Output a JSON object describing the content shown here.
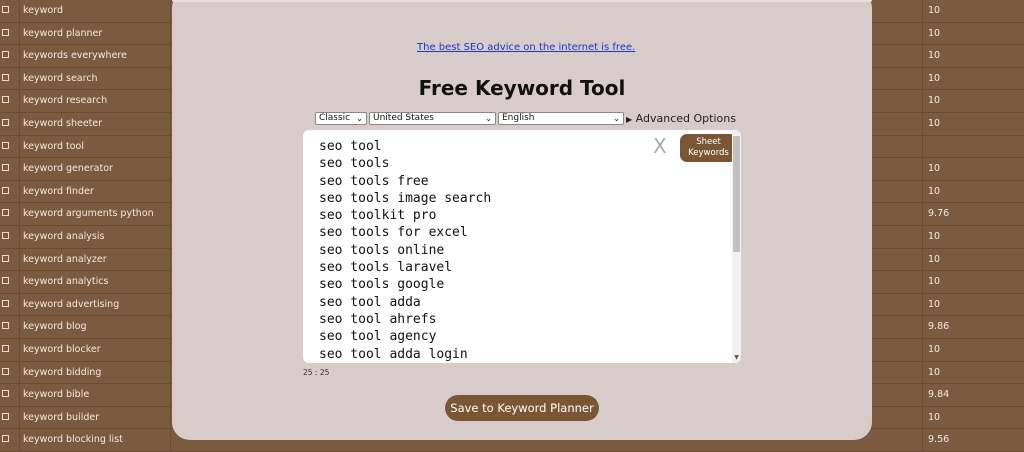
{
  "background_table": {
    "rows": [
      {
        "keyword": "keyword",
        "score": "10"
      },
      {
        "keyword": "keyword planner",
        "score": "10"
      },
      {
        "keyword": "keywords everywhere",
        "score": "10"
      },
      {
        "keyword": "keyword search",
        "score": "10"
      },
      {
        "keyword": "keyword research",
        "score": "10"
      },
      {
        "keyword": "keyword sheeter",
        "score": "10"
      },
      {
        "keyword": "keyword tool",
        "score": ""
      },
      {
        "keyword": "keyword generator",
        "score": "10"
      },
      {
        "keyword": "keyword finder",
        "score": "10"
      },
      {
        "keyword": "keyword arguments python",
        "score": "9.76"
      },
      {
        "keyword": "keyword analysis",
        "score": "10"
      },
      {
        "keyword": "keyword analyzer",
        "score": "10"
      },
      {
        "keyword": "keyword analytics",
        "score": "10"
      },
      {
        "keyword": "keyword advertising",
        "score": "10"
      },
      {
        "keyword": "keyword blog",
        "score": "9.86"
      },
      {
        "keyword": "keyword blocker",
        "score": "10"
      },
      {
        "keyword": "keyword bidding",
        "score": "10"
      },
      {
        "keyword": "keyword bible",
        "score": "9.84"
      },
      {
        "keyword": "keyword builder",
        "score": "10"
      },
      {
        "keyword": "keyword blocking list",
        "score": "9.56"
      }
    ]
  },
  "panel": {
    "seo_link": "The best SEO advice on the internet is free.",
    "title": "Free Keyword Tool",
    "mode_select": "Classic",
    "country_select": "United States",
    "language_select": "English",
    "advanced_toggle_icon": "▶",
    "advanced_label": "Advanced Options",
    "clear_label": "X",
    "sheet_button": {
      "line1": "Sheet",
      "line2": "Keywords"
    },
    "keywords": [
      "seo tool",
      "seo tools",
      "seo tools free",
      "seo tools image search",
      "seo toolkit pro",
      "seo tools for excel",
      "seo tools online",
      "seo tools laravel",
      "seo tools google",
      "seo tool adda",
      "seo tool ahrefs",
      "seo tool agency",
      "seo tool adda login"
    ],
    "counter": "25 : 25",
    "save_button": "Save to Keyword Planner"
  }
}
